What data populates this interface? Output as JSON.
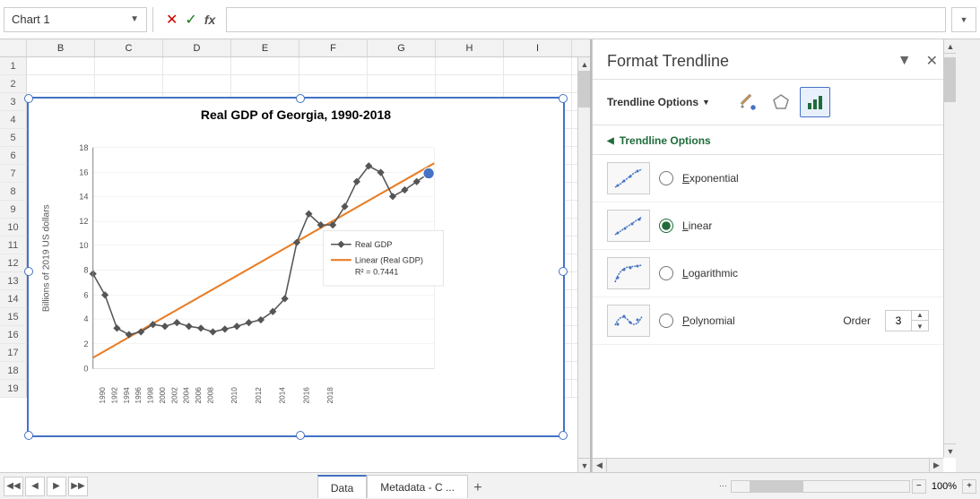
{
  "formulaBar": {
    "nameBox": "Chart 1",
    "nameBoxDropdown": "▼",
    "cancelIcon": "✕",
    "confirmIcon": "✓",
    "fxLabel": "fx",
    "expandIcon": "▼"
  },
  "columns": [
    "B",
    "C",
    "D",
    "E",
    "F",
    "G",
    "H",
    "I"
  ],
  "rows": [
    1,
    2,
    3,
    4,
    5,
    6,
    7,
    8,
    9,
    10,
    11,
    12,
    13,
    14,
    15,
    16,
    17,
    18,
    19
  ],
  "chart": {
    "title": "Real GDP of Georgia, 1990-2018",
    "yAxisLabel": "Billions of 2019 US dollars",
    "yAxisValues": [
      0,
      2,
      4,
      6,
      8,
      10,
      12,
      14,
      16,
      18
    ],
    "legend": {
      "line1": "Real GDP",
      "line2": "Linear (Real GDP)",
      "line3": "R² = 0.7441"
    }
  },
  "formatPanel": {
    "title": "Format Trendline",
    "dropdownIcon": "▼",
    "closeIcon": "✕",
    "sectionLabel": "Trendline Options",
    "sectionDropdown": "▼",
    "iconTabs": {
      "tab1": "paint-bucket",
      "tab2": "pentagon",
      "tab3": "bar-chart"
    },
    "options": [
      {
        "id": "exponential",
        "label": "Exponential",
        "selected": false
      },
      {
        "id": "linear",
        "label": "Linear",
        "selected": true
      },
      {
        "id": "logarithmic",
        "label": "Logarithmic",
        "selected": false
      },
      {
        "id": "polynomial",
        "label": "Polynomial",
        "selected": false
      }
    ],
    "polynomialOrder": {
      "label": "Order",
      "value": "3"
    }
  },
  "bottomTabs": {
    "sheets": [
      "Data",
      "Metadata - C ..."
    ],
    "activeSheet": "Data"
  }
}
